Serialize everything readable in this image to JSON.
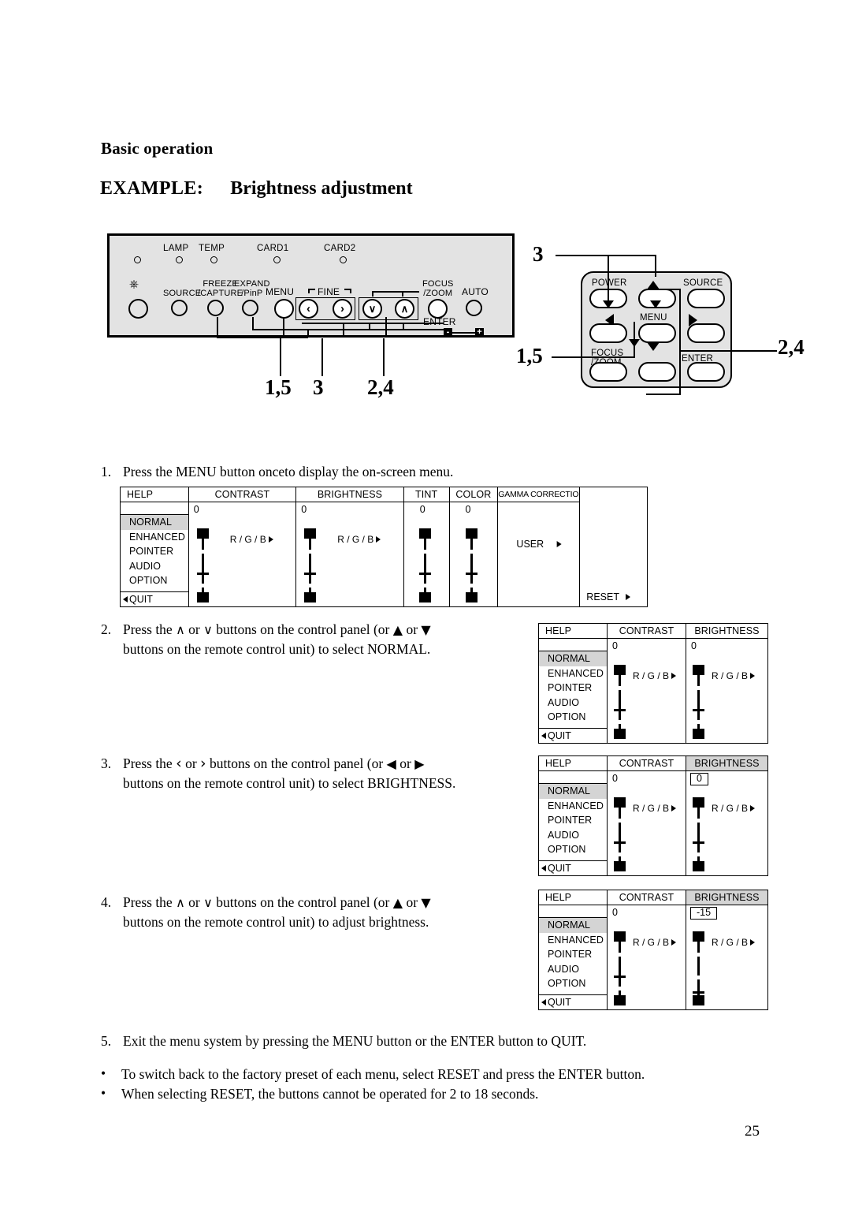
{
  "headings": {
    "section": "Basic operation",
    "example_label": "EXAMPLE:",
    "example_title": "Brightness adjustment"
  },
  "control_panel": {
    "led_labels": [
      "LAMP",
      "TEMP",
      "CARD1",
      "CARD2"
    ],
    "power_icon": "power-symbol",
    "buttons": [
      {
        "name": "power",
        "label": ""
      },
      {
        "name": "source",
        "label": "SOURCE"
      },
      {
        "name": "freeze-capture",
        "label": "FREEZE\n/CAPTURE"
      },
      {
        "name": "expand-pinp",
        "label": "EXPAND\n/PinP"
      },
      {
        "name": "menu",
        "label": "MENU"
      },
      {
        "name": "fine-left",
        "label": "<"
      },
      {
        "name": "fine-right",
        "label": ">"
      },
      {
        "name": "down",
        "label": "v"
      },
      {
        "name": "up",
        "label": "^"
      },
      {
        "name": "focus-zoom",
        "label": "FOCUS\n/ZOOM"
      },
      {
        "name": "auto",
        "label": "AUTO"
      }
    ],
    "group_label_fine": "FINE",
    "group_label_enter": "ENTER",
    "minus_label": "-",
    "plus_label": "+",
    "callouts": [
      "1,5",
      "3",
      "2,4"
    ]
  },
  "remote": {
    "labels": {
      "power": "POWER",
      "source": "SOURCE",
      "menu": "MENU",
      "focus_zoom": "FOCUS\n/ZOOM",
      "enter": "ENTER"
    },
    "focus_zoom_line1": "FOCUS",
    "focus_zoom_line2": "/ZOOM",
    "callouts": {
      "top": "3",
      "left": "1,5",
      "right": "2,4"
    }
  },
  "steps": [
    {
      "num": "1.",
      "text": "Press the MENU button onceto display the on-screen menu."
    },
    {
      "num": "2.",
      "line1_a": "Press the",
      "line1_b": "or",
      "line1_c": "buttons on the control panel (or",
      "line1_d": "or",
      "line2": "buttons on the remote control unit) to select NORMAL.",
      "glyph1": "∧",
      "glyph2": "∨",
      "glyph3": "▲",
      "glyph4": "▼"
    },
    {
      "num": "3.",
      "line1_a": "Press the",
      "line1_b": "or",
      "line1_c": "buttons on the control panel (or",
      "line1_d": "or",
      "line2": "buttons on the remote control unit) to select BRIGHTNESS.",
      "glyph1": "‹",
      "glyph2": "›",
      "glyph3": "◀",
      "glyph4": "▶"
    },
    {
      "num": "4.",
      "line1_a": "Press the",
      "line1_b": "or",
      "line1_c": "buttons on the control panel (or",
      "line1_d": "or",
      "line2": "buttons on the remote control unit) to adjust brightness.",
      "glyph1": "∧",
      "glyph2": "∨",
      "glyph3": "▲",
      "glyph4": "▼"
    },
    {
      "num": "5.",
      "text": "Exit the menu system by pressing the MENU button or the ENTER button to QUIT."
    }
  ],
  "notes": [
    "To switch back to the factory preset of each menu, select RESET and press the ENTER button.",
    "When selecting RESET, the buttons cannot be operated for 2 to 18 seconds."
  ],
  "osd": {
    "sidebar": {
      "header": "HELP",
      "items": [
        "NORMAL",
        "ENHANCED",
        "POINTER",
        "AUDIO",
        "OPTION"
      ],
      "selected": "NORMAL",
      "quit": "QUIT"
    },
    "rgb_label": "R / G / B",
    "reset_label": "RESET",
    "user_label": "USER",
    "menu1": {
      "columns": [
        {
          "header": "CONTRAST",
          "value": "0",
          "rgb": true,
          "highlight": false,
          "boxed": false,
          "tick": 58
        },
        {
          "header": "BRIGHTNESS",
          "value": "0",
          "rgb": true,
          "highlight": false,
          "boxed": false,
          "tick": 58
        },
        {
          "header": "TINT",
          "value": "0",
          "rgb": false,
          "highlight": false,
          "boxed": false,
          "tick": 58
        },
        {
          "header": "COLOR",
          "value": "0",
          "rgb": false,
          "highlight": false,
          "boxed": false,
          "tick": 58
        },
        {
          "header": "GAMMA CORRECTION",
          "value": "",
          "rgb": false,
          "highlight": false,
          "boxed": false,
          "user": true
        }
      ]
    },
    "menu2": {
      "columns": [
        {
          "header": "CONTRAST",
          "value": "0",
          "rgb": true,
          "highlight": false,
          "boxed": false,
          "tick": 58
        },
        {
          "header": "BRIGHTNESS",
          "value": "0",
          "rgb": true,
          "highlight": false,
          "boxed": false,
          "tick": 58
        }
      ]
    },
    "menu3": {
      "columns": [
        {
          "header": "CONTRAST",
          "value": "0",
          "rgb": true,
          "highlight": false,
          "boxed": false,
          "tick": 58
        },
        {
          "header": "BRIGHTNESS",
          "value": "0",
          "rgb": true,
          "highlight": true,
          "boxed": true,
          "tick": 58
        }
      ]
    },
    "menu4": {
      "columns": [
        {
          "header": "CONTRAST",
          "value": "0",
          "rgb": true,
          "highlight": false,
          "boxed": false,
          "tick": 58
        },
        {
          "header": "BRIGHTNESS",
          "value": "-15",
          "rgb": true,
          "highlight": true,
          "boxed": true,
          "tick": 78
        }
      ]
    }
  },
  "page_number": "25"
}
